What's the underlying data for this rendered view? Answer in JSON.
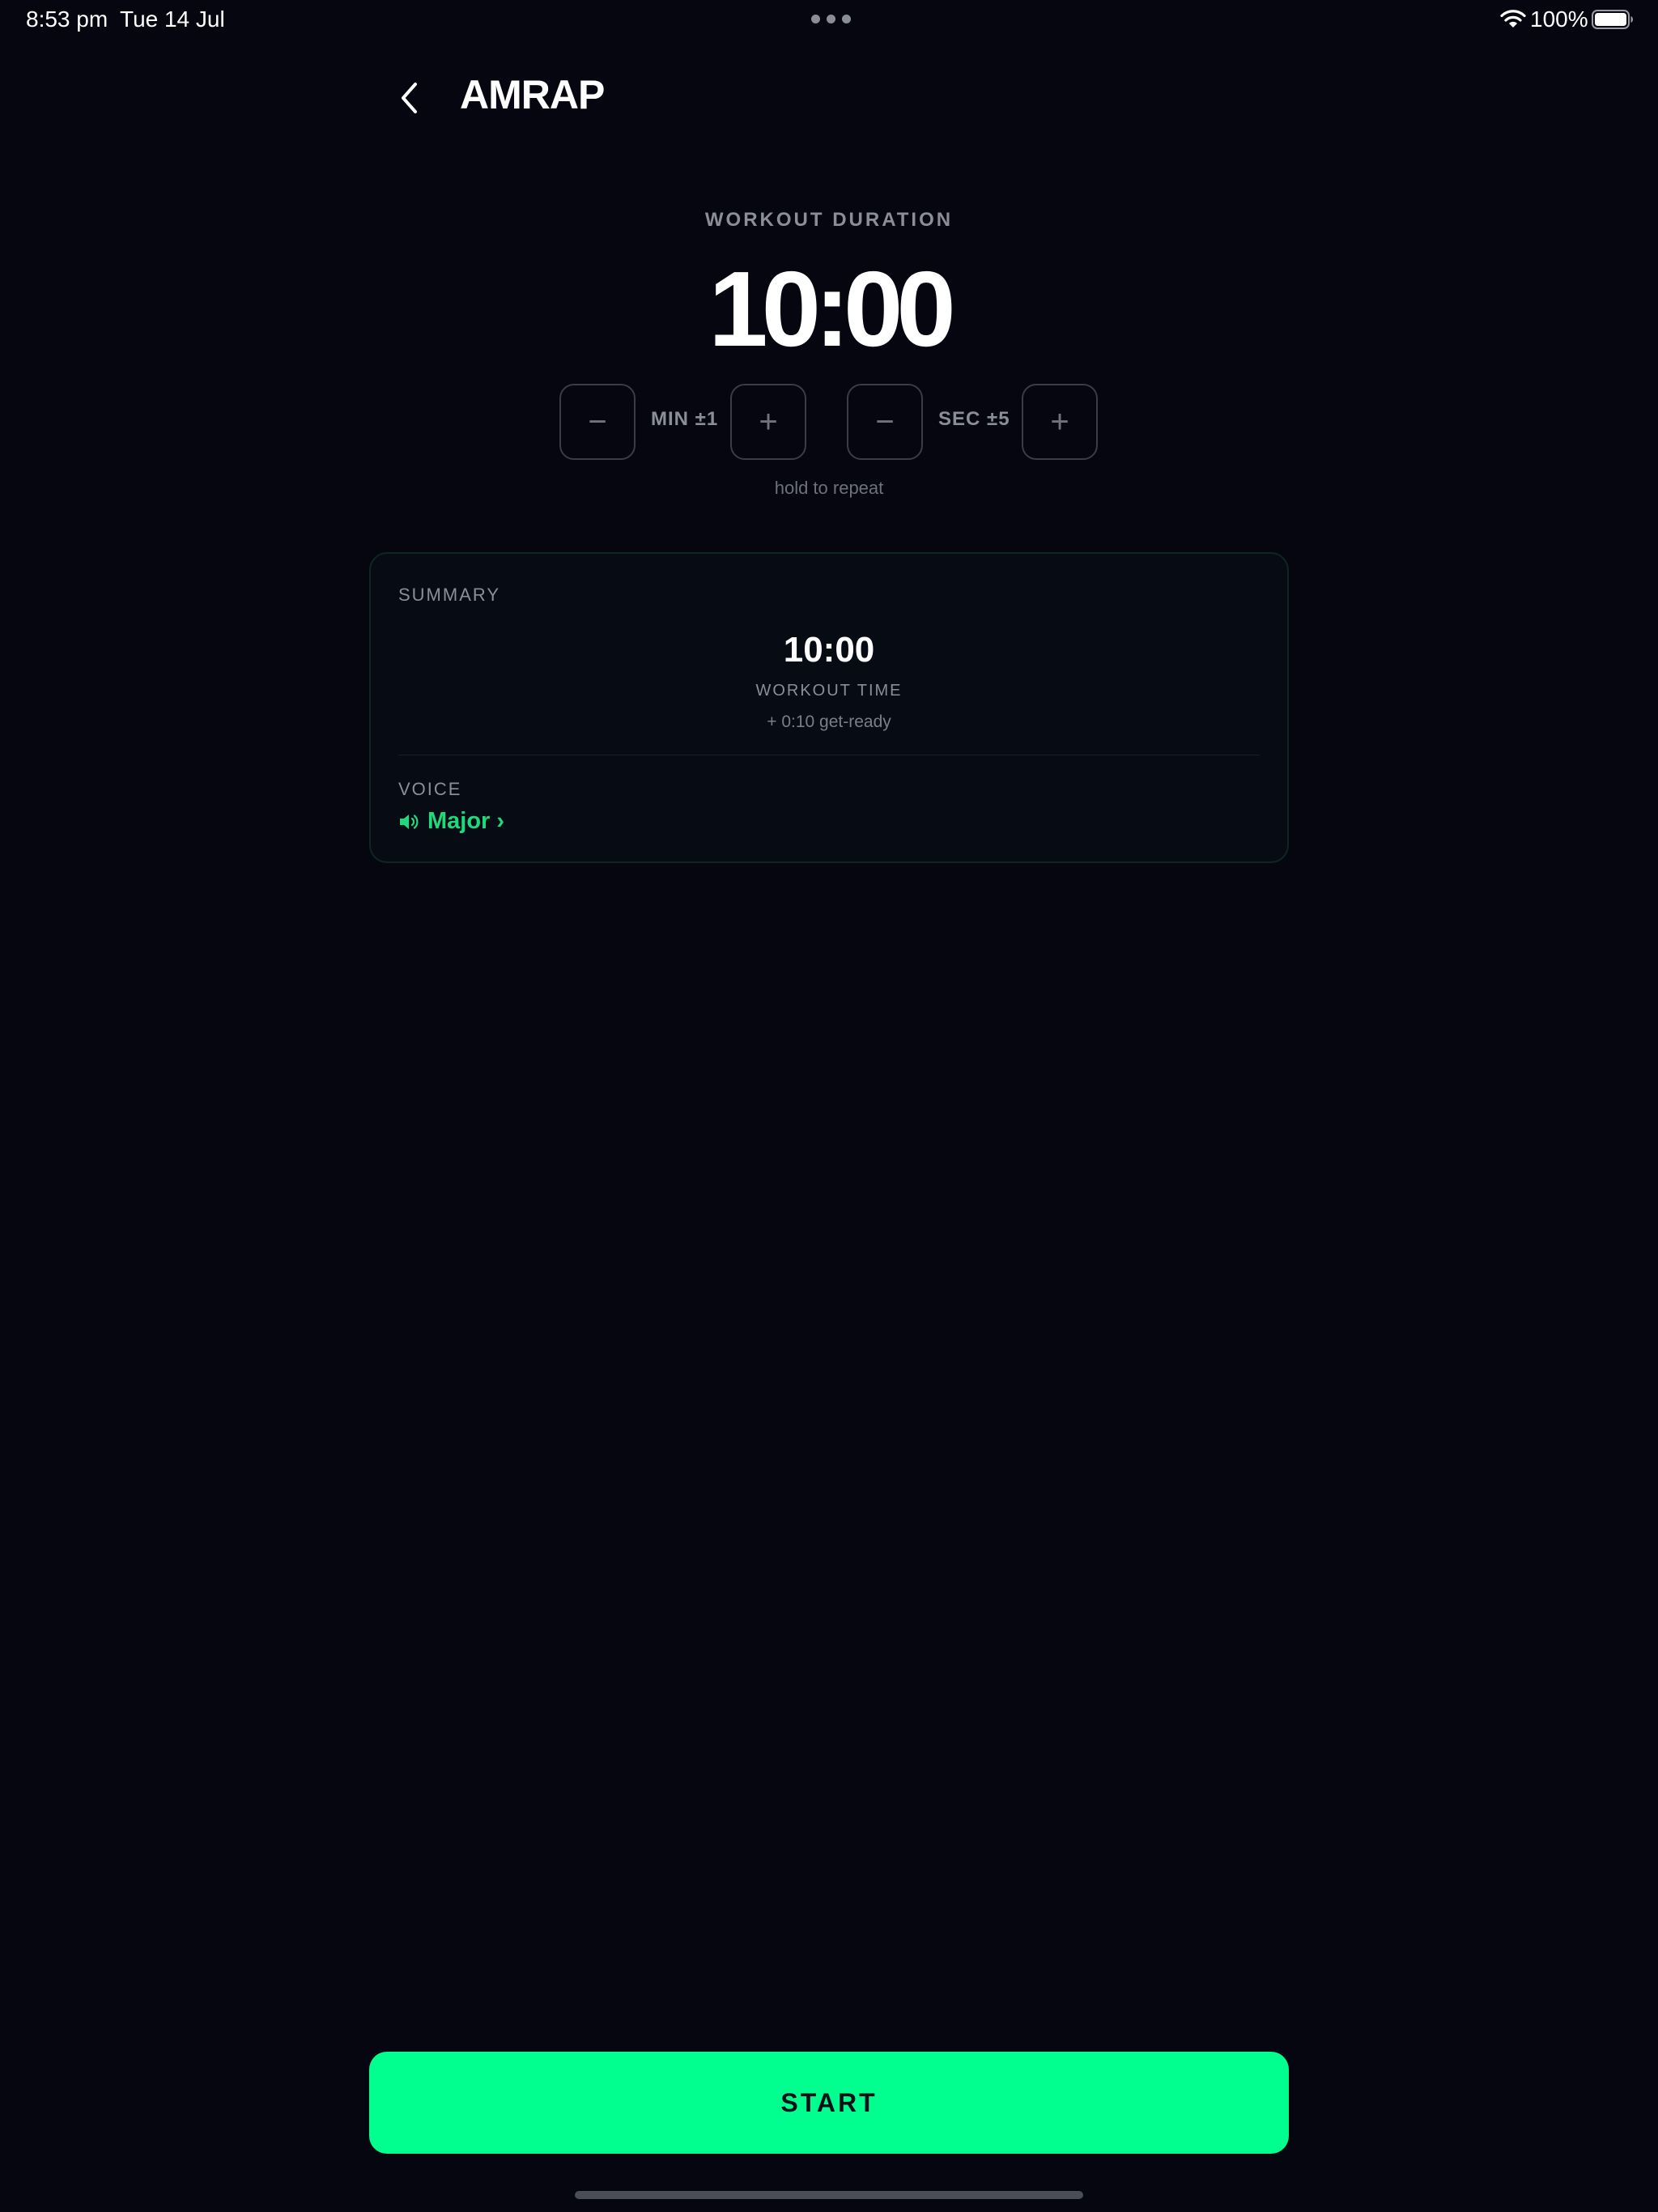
{
  "status_bar": {
    "time": "8:53 pm",
    "date": "Tue 14 Jul",
    "battery": "100%"
  },
  "header": {
    "title": "AMRAP"
  },
  "duration": {
    "label": "WORKOUT DURATION",
    "value": "10:00",
    "min_step_label": "MIN ±1",
    "sec_step_label": "SEC ±5",
    "minus_symbol": "−",
    "plus_symbol": "+",
    "hint": "hold to repeat"
  },
  "summary": {
    "title": "SUMMARY",
    "time": "10:00",
    "time_label": "WORKOUT TIME",
    "get_ready": "+ 0:10 get-ready",
    "voice_label": "VOICE",
    "voice_value": "Major ›"
  },
  "start": {
    "label": "START"
  },
  "colors": {
    "background": "#05060f",
    "accent": "#00ff8f",
    "voice_text": "#1fd97c",
    "muted_text": "#8b8e98"
  }
}
